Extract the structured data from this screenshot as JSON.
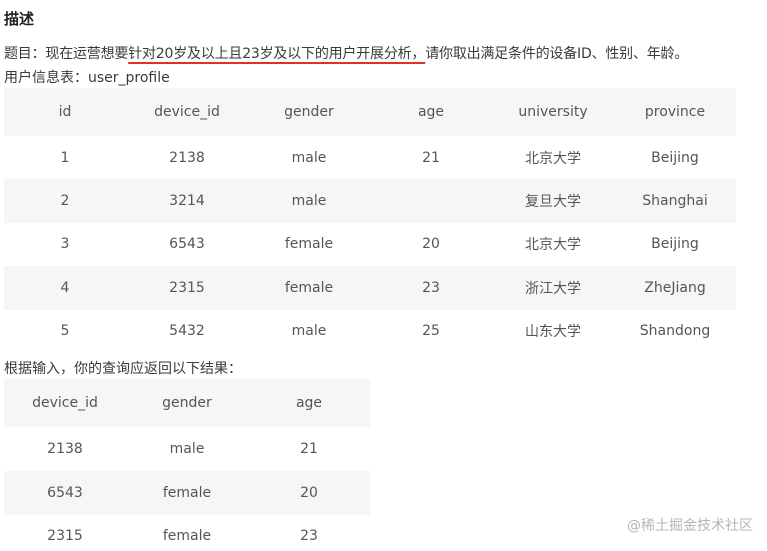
{
  "heading": "描述",
  "question": {
    "prefix": "题目：现在运营想要",
    "highlight": "针对20岁及以上且23岁及以下的用户开展分析，",
    "suffix": "请你取出满足条件的设备ID、性别、年龄。"
  },
  "table_caption": "用户信息表：user_profile",
  "user_table": {
    "columns": [
      "id",
      "device_id",
      "gender",
      "age",
      "university",
      "province"
    ],
    "rows": [
      [
        "1",
        "2138",
        "male",
        "21",
        "北京大学",
        "Beijing"
      ],
      [
        "2",
        "3214",
        "male",
        "",
        "复旦大学",
        "Shanghai"
      ],
      [
        "3",
        "6543",
        "female",
        "20",
        "北京大学",
        "Beijing"
      ],
      [
        "4",
        "2315",
        "female",
        "23",
        "浙江大学",
        "ZheJiang"
      ],
      [
        "5",
        "5432",
        "male",
        "25",
        "山东大学",
        "Shandong"
      ]
    ]
  },
  "result_caption": "根据输入，你的查询应返回以下结果：",
  "result_table": {
    "columns": [
      "device_id",
      "gender",
      "age"
    ],
    "rows": [
      [
        "2138",
        "male",
        "21"
      ],
      [
        "6543",
        "female",
        "20"
      ],
      [
        "2315",
        "female",
        "23"
      ]
    ]
  },
  "watermark": "@稀土掘金技术社区"
}
